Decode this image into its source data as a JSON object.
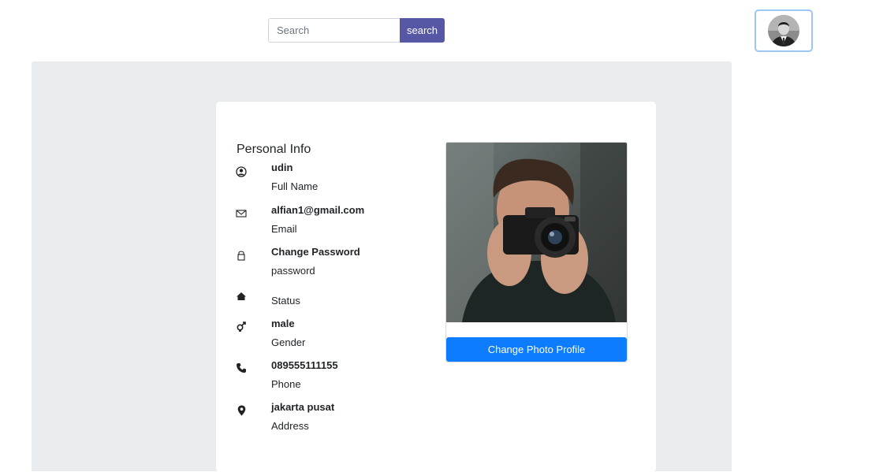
{
  "header": {
    "search": {
      "placeholder": "Search",
      "value": ""
    },
    "search_button_label": "search",
    "avatar_icon": "user-avatar-photo"
  },
  "colors": {
    "search_button": "#5658a6",
    "primary_button": "#0d7cfe",
    "panel_background": "#e9ecef",
    "avatar_border": "#9cc6f3"
  },
  "personal_info": {
    "title": "Personal Info",
    "items": [
      {
        "icon": "user-circle-icon",
        "value": "udin",
        "label": "Full Name"
      },
      {
        "icon": "envelope-icon",
        "value": "alfian1@gmail.com",
        "label": "Email"
      },
      {
        "icon": "lock-icon",
        "value": "Change Password",
        "label": "password"
      },
      {
        "icon": "home-icon",
        "value": "",
        "label": "Status"
      },
      {
        "icon": "gender-icon",
        "value": "male",
        "label": "Gender"
      },
      {
        "icon": "phone-icon",
        "value": "089555111155",
        "label": "Phone"
      },
      {
        "icon": "map-marker-icon",
        "value": "jakarta pusat",
        "label": "Address"
      }
    ]
  },
  "profile_photo": {
    "icon": "profile-photo-camera",
    "button_label": "Change Photo Profile"
  }
}
